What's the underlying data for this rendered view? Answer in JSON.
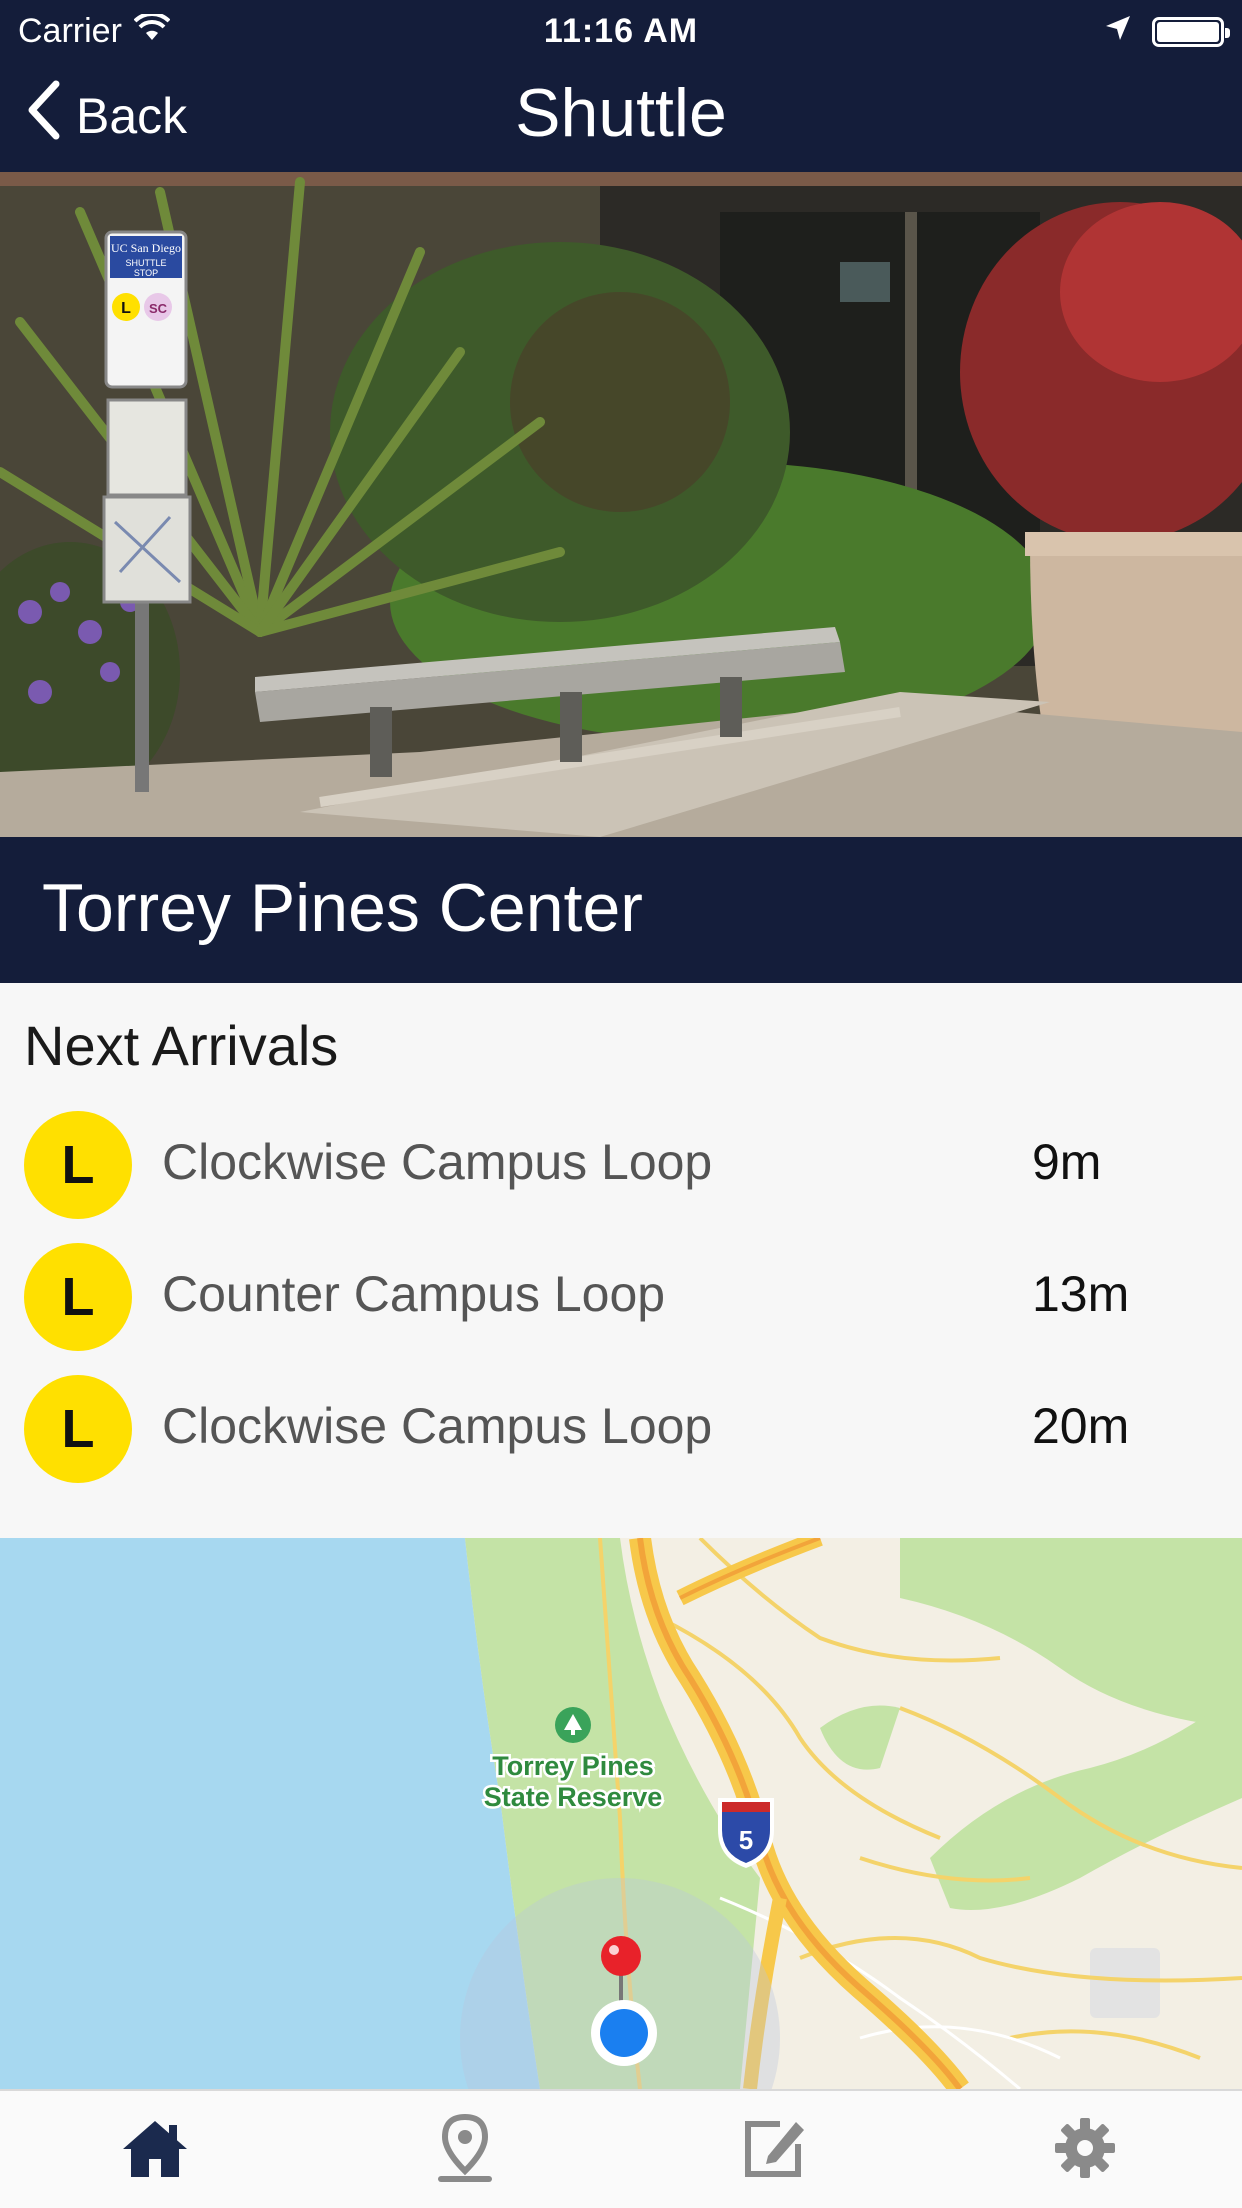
{
  "status_bar": {
    "carrier": "Carrier",
    "time": "11:16 AM"
  },
  "nav": {
    "back_label": "Back",
    "title": "Shuttle"
  },
  "stop": {
    "name": "Torrey Pines Center"
  },
  "arrivals": {
    "heading": "Next Arrivals",
    "items": [
      {
        "badge": "L",
        "route": "Clockwise Campus Loop",
        "eta": "9m"
      },
      {
        "badge": "L",
        "route": "Counter Campus Loop",
        "eta": "13m"
      },
      {
        "badge": "L",
        "route": "Clockwise Campus Loop",
        "eta": "20m"
      }
    ]
  },
  "hero_image": {
    "sign_lines": [
      "UC San Diego",
      "SHUTTLE",
      "STOP"
    ],
    "sign_badges": [
      "L",
      "SC"
    ]
  },
  "map": {
    "place_label_line1": "Torrey Pines",
    "place_label_line2": "State Reserve",
    "highway_shield": "5"
  },
  "tabbar": {
    "tabs": [
      {
        "icon": "home-icon",
        "active": true
      },
      {
        "icon": "map-pin-icon",
        "active": false
      },
      {
        "icon": "edit-icon",
        "active": false
      },
      {
        "icon": "gear-icon",
        "active": false
      }
    ]
  },
  "colors": {
    "navy": "#141d3a",
    "badge_yellow": "#ffe000",
    "tab_active": "#1b2a4e",
    "tab_inactive": "#8a8a8a"
  }
}
